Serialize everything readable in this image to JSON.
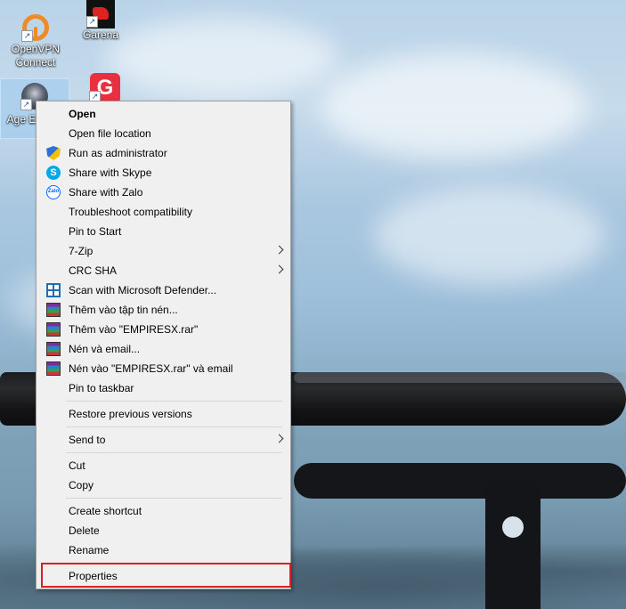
{
  "desktop": {
    "icons": [
      {
        "label": "OpenVPN Connect",
        "name": "openvpn"
      },
      {
        "label": "Garena",
        "name": "garena"
      },
      {
        "label": "Age Empire",
        "name": "age-of-empires"
      },
      {
        "label": "G",
        "name": "g-app"
      }
    ]
  },
  "context_menu": {
    "items": [
      {
        "label": "Open",
        "bold": true
      },
      {
        "label": "Open file location"
      },
      {
        "label": "Run as administrator",
        "icon": "uac-shield-icon"
      },
      {
        "label": "Share with Skype",
        "icon": "skype-icon"
      },
      {
        "label": "Share with Zalo",
        "icon": "zalo-icon"
      },
      {
        "label": "Troubleshoot compatibility"
      },
      {
        "label": "Pin to Start"
      },
      {
        "label": "7-Zip",
        "submenu": true
      },
      {
        "label": "CRC SHA",
        "submenu": true
      },
      {
        "label": "Scan with Microsoft Defender...",
        "icon": "defender-icon"
      },
      {
        "label": "Thêm vào tập tin nén...",
        "icon": "winrar-icon"
      },
      {
        "label": "Thêm vào \"EMPIRESX.rar\"",
        "icon": "winrar-icon"
      },
      {
        "label": "Nén và email...",
        "icon": "winrar-icon"
      },
      {
        "label": "Nén vào \"EMPIRESX.rar\" và email",
        "icon": "winrar-icon"
      },
      {
        "label": "Pin to taskbar"
      },
      {
        "label": "Restore previous versions"
      },
      {
        "label": "Send to",
        "submenu": true
      },
      {
        "label": "Cut"
      },
      {
        "label": "Copy"
      },
      {
        "label": "Create shortcut"
      },
      {
        "label": "Delete"
      },
      {
        "label": "Rename"
      },
      {
        "label": "Properties",
        "highlighted": true
      }
    ]
  },
  "colors": {
    "menu_bg": "#f0f0f0",
    "highlight_border": "#d6202a"
  }
}
